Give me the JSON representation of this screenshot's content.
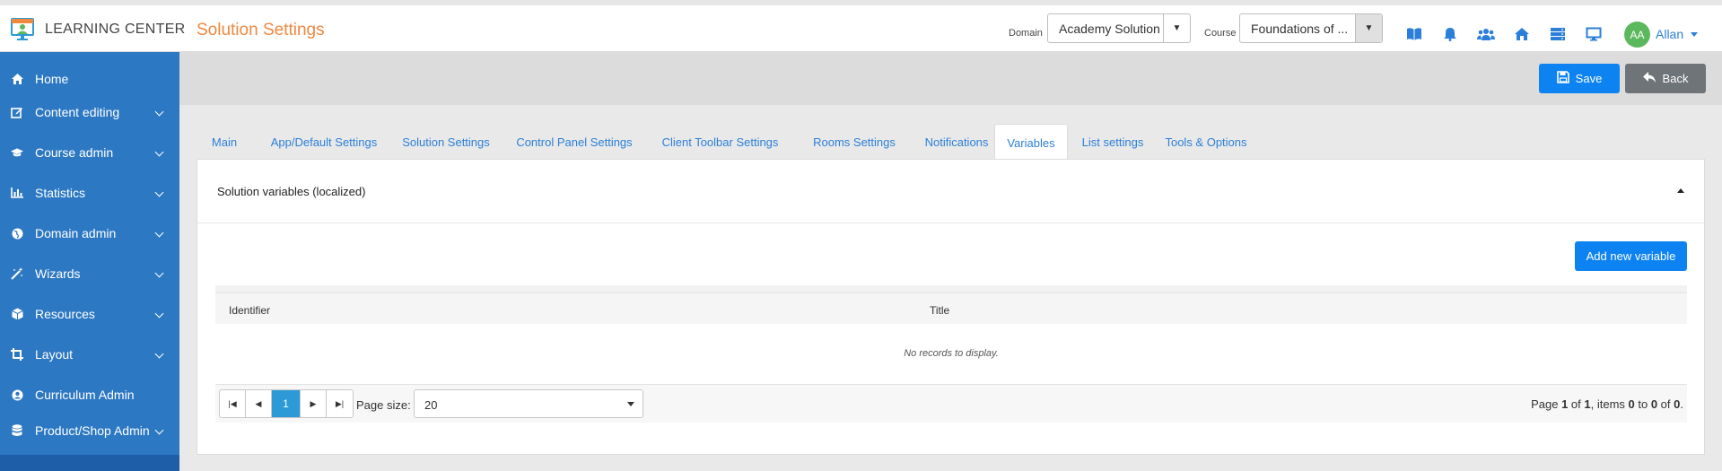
{
  "app": {
    "brand": "LEARNING CENTER",
    "page_title": "Solution Settings"
  },
  "header": {
    "domain_label": "Domain",
    "domain_value": "Academy Solution",
    "course_label": "Course",
    "course_value": "Foundations of ...",
    "icons": [
      "book-icon",
      "bell-icon",
      "users-icon",
      "home-icon",
      "server-icon",
      "monitor-icon"
    ],
    "user_initials": "AA",
    "user_name": "Allan"
  },
  "sidebar": {
    "items": [
      {
        "label": "Home",
        "icon": "home-icon",
        "has_children": false
      },
      {
        "label": "Content editing",
        "icon": "edit-icon",
        "has_children": true
      },
      {
        "label": "Course admin",
        "icon": "graduation-cap-icon",
        "has_children": true
      },
      {
        "label": "Statistics",
        "icon": "bar-chart-icon",
        "has_children": true
      },
      {
        "label": "Domain admin",
        "icon": "globe-icon",
        "has_children": true
      },
      {
        "label": "Wizards",
        "icon": "magic-wand-icon",
        "has_children": true
      },
      {
        "label": "Resources",
        "icon": "cube-icon",
        "has_children": true
      },
      {
        "label": "Layout",
        "icon": "crop-icon",
        "has_children": true
      },
      {
        "label": "Curriculum Admin",
        "icon": "user-circle-icon",
        "has_children": false
      },
      {
        "label": "Product/Shop Admin",
        "icon": "database-icon",
        "has_children": true
      }
    ]
  },
  "actions": {
    "save_label": "Save",
    "back_label": "Back"
  },
  "tabs": [
    {
      "label": "Main",
      "active": false
    },
    {
      "label": "App/Default Settings",
      "active": false
    },
    {
      "label": "Solution Settings",
      "active": false
    },
    {
      "label": "Control Panel Settings",
      "active": false
    },
    {
      "label": "Client Toolbar Settings",
      "active": false
    },
    {
      "label": "Rooms Settings",
      "active": false
    },
    {
      "label": "Notifications",
      "active": false
    },
    {
      "label": "Variables",
      "active": true
    },
    {
      "label": "List settings",
      "active": false
    },
    {
      "label": "Tools & Options",
      "active": false
    }
  ],
  "panel": {
    "title": "Solution variables (localized)",
    "add_button_label": "Add new variable"
  },
  "grid": {
    "columns": [
      "Identifier",
      "Title"
    ],
    "empty_text": "No records to display."
  },
  "pager": {
    "current_page": "1",
    "page_size_label": "Page size:",
    "page_size_value": "20",
    "info": {
      "page": "1",
      "pages": "1",
      "from": "0",
      "to": "0",
      "total": "0"
    }
  },
  "colors": {
    "sidebar_bg": "#2d78c3",
    "accent": "#0d83f2",
    "title_orange": "#f0883e",
    "back_button": "#6f7479"
  }
}
